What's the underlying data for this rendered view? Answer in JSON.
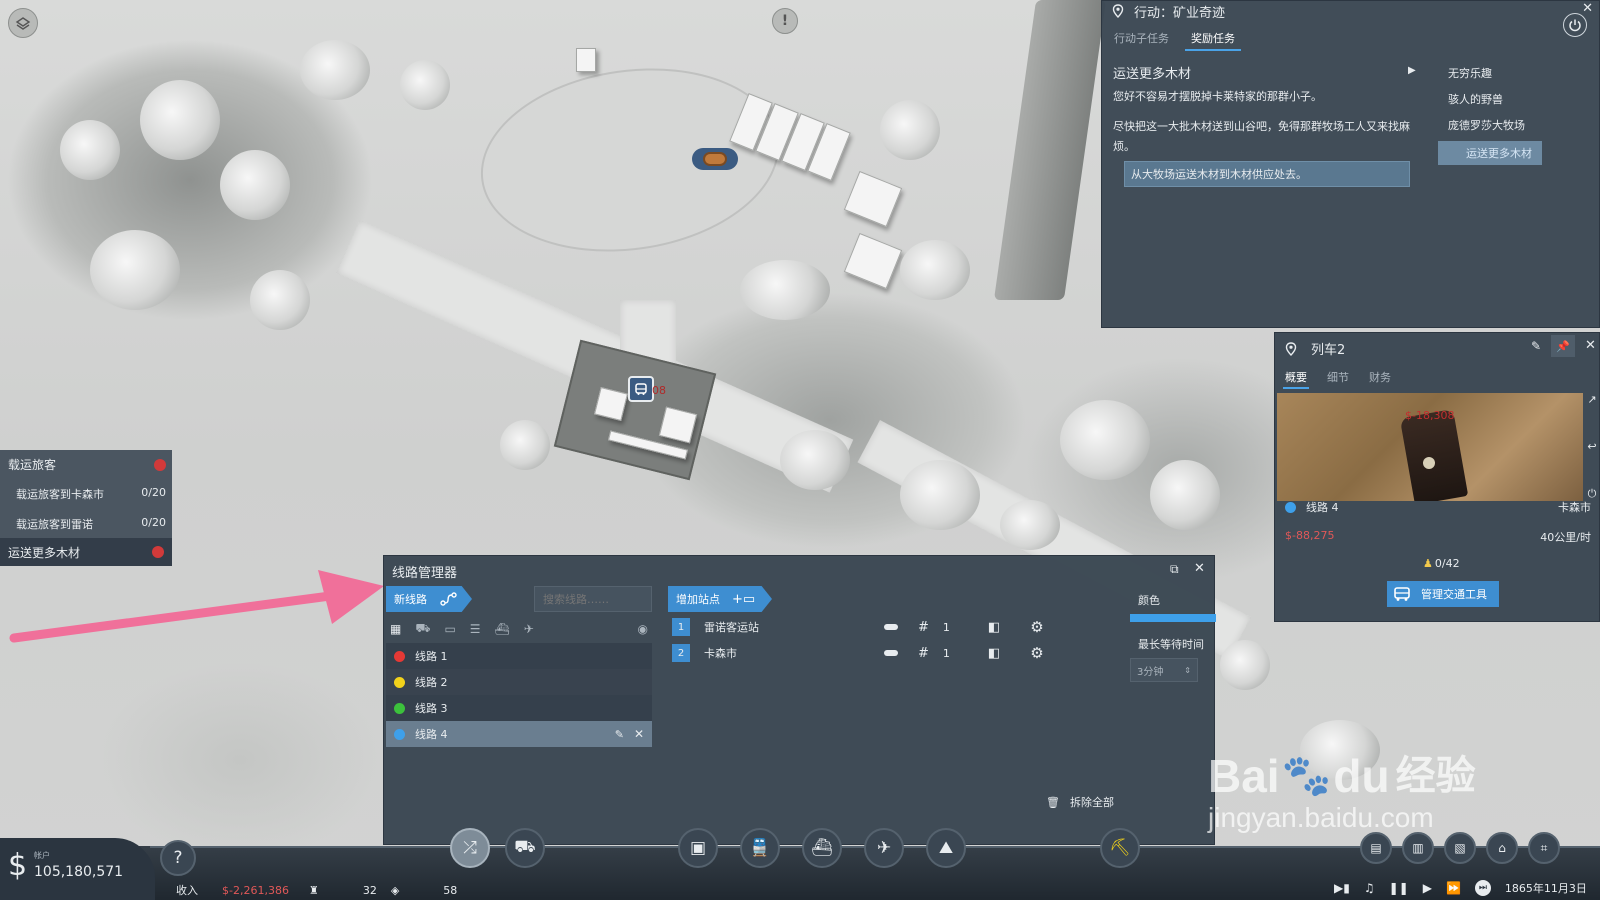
{
  "quest": {
    "title": "行动：矿业奇迹",
    "tabs": [
      "行动子任务",
      "奖励任务"
    ],
    "task_title": "运送更多木材",
    "desc1": "您好不容易才摆脱掉卡莱特家的那群小子。",
    "desc2": "尽快把这一大批木材送到山谷吧，免得那群牧场工人又来找麻烦。",
    "objective": "从大牧场运送木材到木材供应处去。",
    "side_items": [
      "无穷乐趣",
      "骇人的野兽",
      "庞德罗莎大牧场",
      "运送更多木材"
    ]
  },
  "tracker": {
    "header": "载运旅客",
    "items": [
      {
        "label": "载运旅客到卡森市",
        "count": "0/20"
      },
      {
        "label": "载运旅客到雷诺",
        "count": "0/20"
      }
    ],
    "footer": "运送更多木材"
  },
  "train": {
    "title": "列车2",
    "tabs": [
      "概要",
      "细节",
      "财务"
    ],
    "thumb_profit": "$-18,308",
    "line": "线路 4",
    "destination": "卡森市",
    "profit": "$-88,275",
    "speed": "40公里/时",
    "passengers": "0/42",
    "manage_btn": "管理交通工具"
  },
  "line_manager": {
    "title": "线路管理器",
    "new_line": "新线路",
    "search_placeholder": "搜索线路……",
    "add_stop": "增加站点",
    "lines": [
      {
        "name": "线路 1",
        "color": "#e53935"
      },
      {
        "name": "线路 2",
        "color": "#f2d21b"
      },
      {
        "name": "线路 3",
        "color": "#3cc13c"
      },
      {
        "name": "线路 4",
        "color": "#3ea0ea"
      }
    ],
    "stops": [
      {
        "num": "1",
        "name": "雷诺客运站",
        "count": "1"
      },
      {
        "num": "2",
        "name": "卡森市",
        "count": "1"
      }
    ],
    "color_label": "颜色",
    "line_color": "#3ea0ea",
    "wait_label": "最长等待时间",
    "wait_value": "3分钟",
    "delete_all": "拆除全部"
  },
  "map": {
    "station_label": "08"
  },
  "status": {
    "account_label": "帐户",
    "account_value": "105,180,571",
    "income_label": "收入",
    "income_value": "$-2,261,386",
    "stat1": "32",
    "stat2": "58",
    "date": "1865年11月3日"
  },
  "watermark": {
    "brand_a": "Bai",
    "brand_b": "du",
    "brand_c": "经验",
    "url": "jingyan.baidu.com"
  }
}
